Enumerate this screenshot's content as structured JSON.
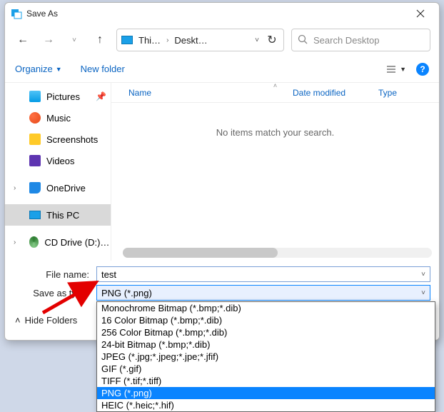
{
  "title": "Save As",
  "nav": {
    "path_segment1": "Thi…",
    "path_segment2": "Deskt…"
  },
  "search": {
    "placeholder": "Search Desktop"
  },
  "toolbar": {
    "organize": "Organize",
    "newfolder": "New folder"
  },
  "sidebar": {
    "pictures": "Pictures",
    "music": "Music",
    "screenshots": "Screenshots",
    "videos": "Videos",
    "onedrive": "OneDrive",
    "thispc": "This PC",
    "cddrive": "CD Drive (D:) CCO"
  },
  "columns": {
    "name": "Name",
    "date": "Date modified",
    "type": "Type"
  },
  "empty_msg": "No items match your search.",
  "fields": {
    "filename_label": "File name:",
    "filename_value": "test",
    "savetype_label": "Save as type:",
    "savetype_value": "PNG (*.png)"
  },
  "hide_folders": "Hide Folders",
  "filetypes": [
    "Monochrome Bitmap (*.bmp;*.dib)",
    "16 Color Bitmap (*.bmp;*.dib)",
    "256 Color Bitmap (*.bmp;*.dib)",
    "24-bit Bitmap (*.bmp;*.dib)",
    "JPEG (*.jpg;*.jpeg;*.jpe;*.jfif)",
    "GIF (*.gif)",
    "TIFF (*.tif;*.tiff)",
    "PNG (*.png)",
    "HEIC (*.heic;*.hif)"
  ],
  "filetype_selected_index": 7
}
